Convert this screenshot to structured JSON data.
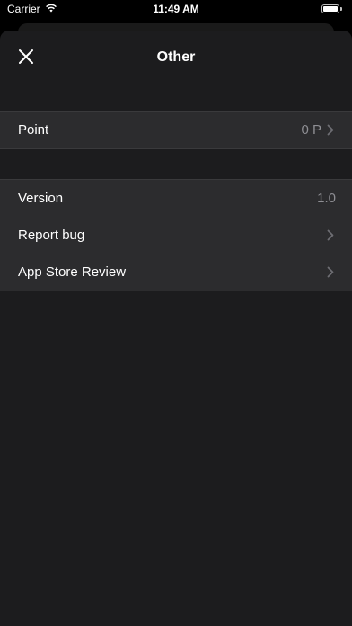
{
  "status_bar": {
    "carrier": "Carrier",
    "time": "11:49 AM"
  },
  "nav": {
    "title": "Other",
    "close_icon": "close-icon"
  },
  "points_group": {
    "items": [
      {
        "label": "Point",
        "value": "0 P",
        "has_chevron": true
      }
    ]
  },
  "info_group": {
    "items": [
      {
        "label": "Version",
        "value": "1.0",
        "has_chevron": false
      },
      {
        "label": "Report bug",
        "value": "",
        "has_chevron": true
      },
      {
        "label": "App Store Review",
        "value": "",
        "has_chevron": true
      }
    ]
  },
  "colors": {
    "background": "#1c1c1e",
    "cell": "#2c2c2e",
    "secondary_text": "#8e8e93"
  }
}
